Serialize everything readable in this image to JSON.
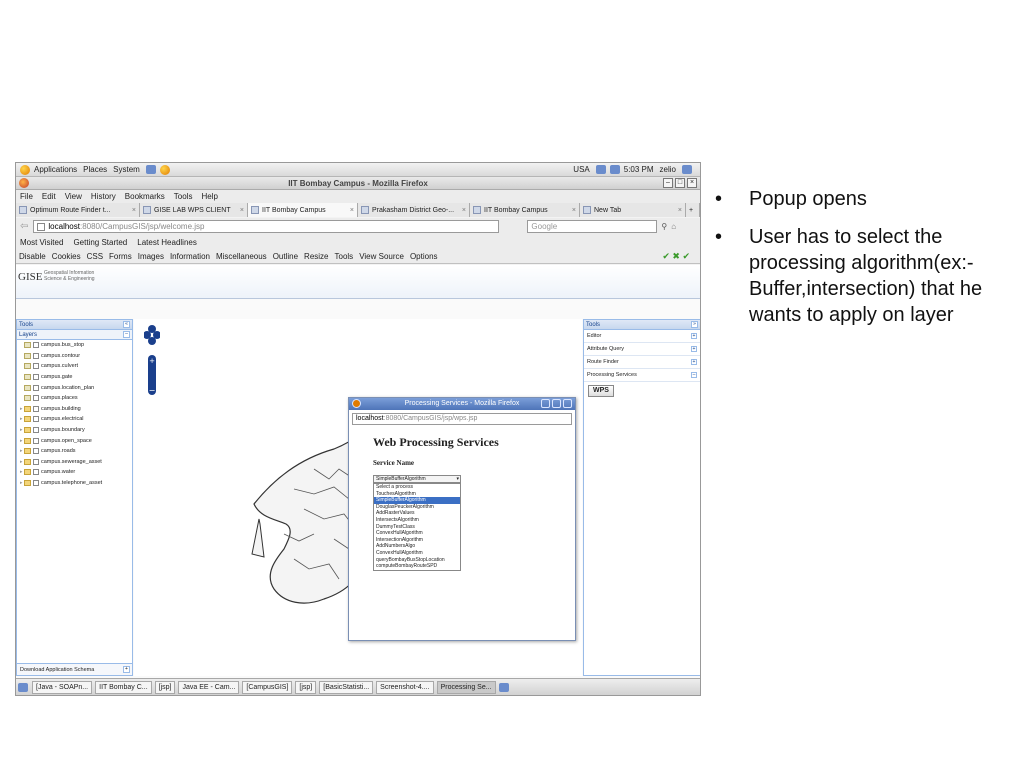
{
  "gnome_panel": {
    "items": [
      "Applications",
      "Places",
      "System"
    ],
    "keyboard": "USA",
    "time": "5:03 PM",
    "user": "zelio"
  },
  "window_title": "IIT Bombay Campus - Mozilla Firefox",
  "menu": [
    "File",
    "Edit",
    "View",
    "History",
    "Bookmarks",
    "Tools",
    "Help"
  ],
  "tabs": [
    {
      "label": "Optimum Route Finder t...",
      "active": false
    },
    {
      "label": "GISE LAB WPS CLIENT",
      "active": false
    },
    {
      "label": "IIT Bombay Campus",
      "active": true
    },
    {
      "label": "Prakasham District Geo-...",
      "active": false
    },
    {
      "label": "IIT Bombay Campus",
      "active": false
    },
    {
      "label": "New Tab",
      "active": false
    }
  ],
  "url": {
    "host": "localhost",
    "path": ":8080/CampusGIS/jsp/welcome.jsp"
  },
  "search_placeholder": "Google",
  "bookmarks": [
    "Most Visited",
    "Getting Started",
    "Latest Headlines"
  ],
  "webdev": [
    "Disable",
    "Cookies",
    "CSS",
    "Forms",
    "Images",
    "Information",
    "Miscellaneous",
    "Outline",
    "Resize",
    "Tools",
    "View Source",
    "Options"
  ],
  "gise": {
    "logo": "GISE",
    "subtitle_line1": "Geospatial Information",
    "subtitle_line2": "Science & Engineering"
  },
  "left_panel": {
    "title": "Tools",
    "section": "Layers",
    "layers": [
      {
        "label": "campus.bus_stop",
        "type": "point"
      },
      {
        "label": "campus.contour",
        "type": "point"
      },
      {
        "label": "campus.culvert",
        "type": "point"
      },
      {
        "label": "campus.gate",
        "type": "point"
      },
      {
        "label": "campus.location_plan",
        "type": "point"
      },
      {
        "label": "campus.places",
        "type": "point"
      },
      {
        "label": "campus.building",
        "type": "folder"
      },
      {
        "label": "campus.electrical",
        "type": "folder"
      },
      {
        "label": "campus.boundary",
        "type": "folder"
      },
      {
        "label": "campus.open_space",
        "type": "folder"
      },
      {
        "label": "campus.roads",
        "type": "folder"
      },
      {
        "label": "campus.sewerage_asset",
        "type": "folder"
      },
      {
        "label": "campus.water",
        "type": "folder"
      },
      {
        "label": "campus.telephone_asset",
        "type": "folder"
      }
    ],
    "footer": "Download Application Schema"
  },
  "right_panel": {
    "title": "Tools",
    "items": [
      "Editor",
      "Attribute Query",
      "Route Finder",
      "Processing Services"
    ],
    "wps_button": "WPS"
  },
  "popup": {
    "title": "Processing Services - Mozilla Firefox",
    "url": {
      "host": "localhost",
      "path": ":8080/CampusGIS/jsp/wps.jsp"
    },
    "heading": "Web Processing Services",
    "service_label": "Service Name",
    "selected": "SimpleBufferAlgorithm",
    "options": [
      {
        "label": "Select a process",
        "selected": false
      },
      {
        "label": "TouchesAlgorithm",
        "selected": false
      },
      {
        "label": "SimpleBufferAlgorithm",
        "selected": true
      },
      {
        "label": "DouglasPeuckerAlgorithm",
        "selected": false
      },
      {
        "label": "AddRasterValues",
        "selected": false
      },
      {
        "label": "IntersectsAlgorithm",
        "selected": false
      },
      {
        "label": "DummyTestClass",
        "selected": false
      },
      {
        "label": "ConvexHullAlgorithm",
        "selected": false
      },
      {
        "label": "IntersectionAlgorithm",
        "selected": false
      },
      {
        "label": "AddNumbersAlgo",
        "selected": false
      },
      {
        "label": "ConvexHullAlgorithm",
        "selected": false
      },
      {
        "label": "queryBombayBusStopLocation",
        "selected": false
      },
      {
        "label": "computeBombayRouteSPD",
        "selected": false
      }
    ]
  },
  "taskbar": [
    "[Java - SOAPn...",
    "IIT Bombay C...",
    "[jsp]",
    "Java EE - Cam...",
    "[CampusGIS]",
    "[jsp]",
    "[BasicStatisti...",
    "Screenshot-4....",
    "Processing Se..."
  ],
  "bullets": [
    "Popup opens",
    "User has to select the processing algorithm(ex:-Buffer,intersection) that he wants to apply on layer"
  ]
}
